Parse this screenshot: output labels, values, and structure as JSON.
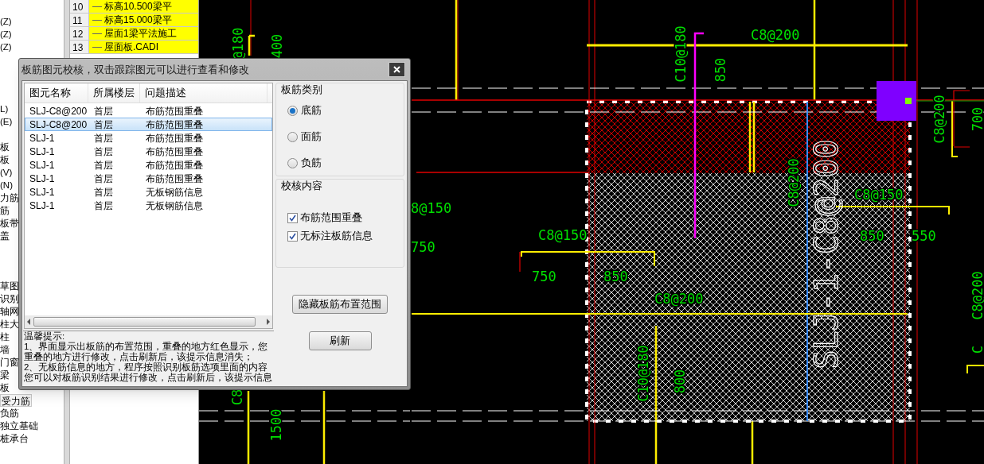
{
  "tree": {
    "groups": [
      {
        "items": [
          {
            "label": "(Z)",
            "selected": false
          },
          {
            "label": "(Z)",
            "selected": false
          },
          {
            "label": "(Z)",
            "selected": false
          }
        ]
      },
      {
        "items": [
          {
            "label": "L)",
            "selected": false
          },
          {
            "label": "(E)",
            "selected": false
          }
        ]
      },
      {
        "items": [
          {
            "label": "板",
            "selected": false
          },
          {
            "label": "板",
            "selected": false
          },
          {
            "label": "(V)",
            "selected": false
          },
          {
            "label": "(N)",
            "selected": false
          },
          {
            "label": "力筋",
            "selected": false
          },
          {
            "label": "筋",
            "selected": false
          },
          {
            "label": "板带",
            "selected": false
          },
          {
            "label": "盖",
            "selected": false
          }
        ]
      },
      {
        "items": [
          {
            "label": "草图",
            "selected": false
          },
          {
            "label": "识别",
            "selected": false
          },
          {
            "label": "轴网",
            "selected": false
          },
          {
            "label": "柱大",
            "selected": false
          },
          {
            "label": "柱",
            "selected": false
          },
          {
            "label": "墙",
            "selected": false
          },
          {
            "label": "门窗",
            "selected": false
          },
          {
            "label": "梁",
            "selected": false
          },
          {
            "label": "板",
            "selected": false
          },
          {
            "label": "受力筋",
            "selected": true
          },
          {
            "label": "负筋",
            "selected": false
          },
          {
            "label": "独立基础",
            "selected": false
          },
          {
            "label": "桩承台",
            "selected": false
          }
        ]
      }
    ]
  },
  "drawing_list": {
    "rows": [
      {
        "number": "10",
        "name": "标高10.500梁平"
      },
      {
        "number": "11",
        "name": "标高15.000梁平"
      },
      {
        "number": "12",
        "name": "屋面1梁平法施工"
      },
      {
        "number": "13",
        "name": "屋面板.CADI"
      }
    ]
  },
  "dialog": {
    "title": "板筋图元校核，双击跟踪图元可以进行查看和修改",
    "columns": [
      "图元名称",
      "所属楼层",
      "问题描述"
    ],
    "rows": [
      {
        "name": "SLJ-C8@200",
        "floor": "首层",
        "issue": "布筋范围重叠",
        "selected": false
      },
      {
        "name": "SLJ-C8@200",
        "floor": "首层",
        "issue": "布筋范围重叠",
        "selected": true
      },
      {
        "name": "SLJ-1",
        "floor": "首层",
        "issue": "布筋范围重叠",
        "selected": false
      },
      {
        "name": "SLJ-1",
        "floor": "首层",
        "issue": "布筋范围重叠",
        "selected": false
      },
      {
        "name": "SLJ-1",
        "floor": "首层",
        "issue": "布筋范围重叠",
        "selected": false
      },
      {
        "name": "SLJ-1",
        "floor": "首层",
        "issue": "布筋范围重叠",
        "selected": false
      },
      {
        "name": "SLJ-1",
        "floor": "首层",
        "issue": "无板钢筋信息",
        "selected": false
      },
      {
        "name": "SLJ-1",
        "floor": "首层",
        "issue": "无板钢筋信息",
        "selected": false
      }
    ],
    "tips": [
      "温馨提示:",
      "1、界面显示出板筋的布置范围，重叠的地方红色显示，您",
      "重叠的地方进行修改，点击刷新后，该提示信息消失；",
      "2、无板筋信息的地方，程序按照识别板筋选项里面的内容",
      "您可以对板筋识别结果进行修改，点击刷新后，该提示信息"
    ],
    "rebar_type": {
      "title": "板筋类别",
      "options": [
        {
          "label": "底筋",
          "selected": true
        },
        {
          "label": "面筋",
          "selected": false
        },
        {
          "label": "负筋",
          "selected": false
        }
      ]
    },
    "check_content": {
      "title": "校核内容",
      "options": [
        {
          "label": "布筋范围重叠",
          "checked": true
        },
        {
          "label": "无标注板筋信息",
          "checked": true
        }
      ]
    },
    "buttons": [
      "隐藏板筋布置范围",
      "刷新"
    ]
  },
  "cad_labels": [
    {
      "text": "C8@200",
      "kind": "h"
    },
    {
      "text": "C10@180",
      "kind": "v"
    },
    {
      "text": "850",
      "kind": "v"
    },
    {
      "text": "@180",
      "kind": "v"
    },
    {
      "text": "400",
      "kind": "v"
    },
    {
      "text": "8@150",
      "kind": "h"
    },
    {
      "text": "C8@150",
      "kind": "h"
    },
    {
      "text": "750",
      "kind": "h"
    },
    {
      "text": "750",
      "kind": "h"
    },
    {
      "text": "550",
      "kind": "h"
    },
    {
      "text": "C8@200",
      "kind": "v"
    },
    {
      "text": "700",
      "kind": "v"
    },
    {
      "text": "C8@200",
      "kind": "v"
    },
    {
      "text": "C",
      "kind": "v"
    },
    {
      "text": "C8",
      "kind": "v"
    },
    {
      "text": "1500",
      "kind": "v"
    },
    {
      "text": "C8@200",
      "kind": "v"
    },
    {
      "text": "C8@150",
      "kind": "h"
    },
    {
      "text": "850",
      "kind": "h"
    },
    {
      "text": "850",
      "kind": "h"
    },
    {
      "text": "C8@200",
      "kind": "h"
    },
    {
      "text": "C10@180",
      "kind": "v"
    },
    {
      "text": "800",
      "kind": "v"
    },
    {
      "text": "SLJ-1-C8@200",
      "kind": "big"
    }
  ]
}
